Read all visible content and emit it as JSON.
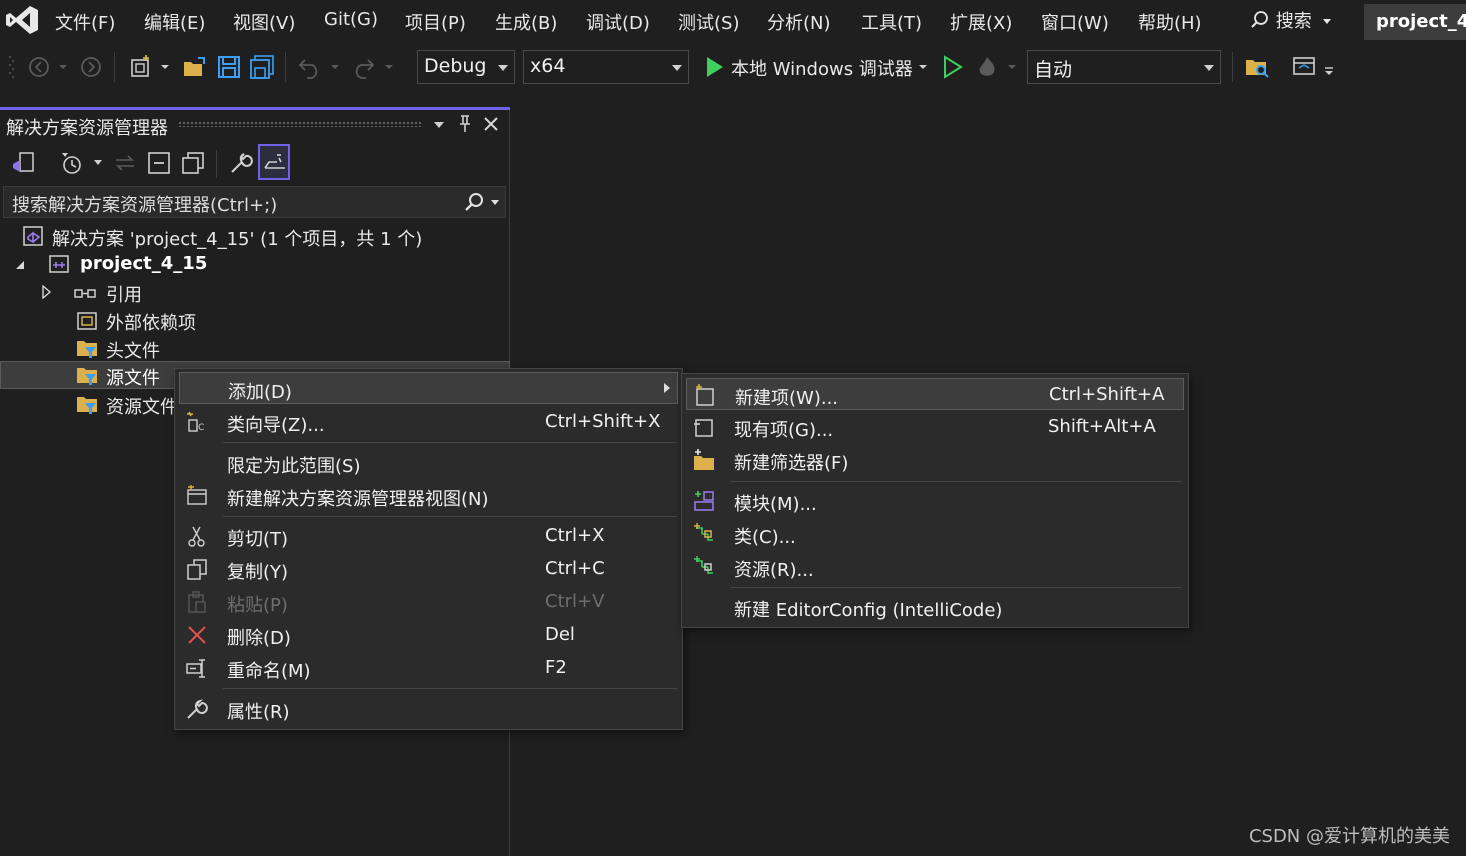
{
  "menubar": {
    "items": [
      "文件(F)",
      "编辑(E)",
      "视图(V)",
      "Git(G)",
      "项目(P)",
      "生成(B)",
      "调试(D)",
      "测试(S)",
      "分析(N)",
      "工具(T)",
      "扩展(X)",
      "窗口(W)",
      "帮助(H)"
    ],
    "search_label": "搜索",
    "project_badge": "project_4"
  },
  "toolbar": {
    "configuration": "Debug",
    "platform": "x64",
    "debugger_label": "本地 Windows 调试器",
    "auto_label": "自动"
  },
  "solution_explorer": {
    "title": "解决方案资源管理器",
    "search_placeholder": "搜索解决方案资源管理器(Ctrl+;)",
    "tree": {
      "solution": "解决方案 'project_4_15' (1 个项目，共 1 个)",
      "project": "project_4_15",
      "references": "引用",
      "external_deps": "外部依赖项",
      "header_files": "头文件",
      "source_files": "源文件",
      "resource_files": "资源文件"
    }
  },
  "context_menu": {
    "add": "添加(D)",
    "class_wizard": "类向导(Z)...",
    "class_wizard_shortcut": "Ctrl+Shift+X",
    "scope": "限定为此范围(S)",
    "new_view": "新建解决方案资源管理器视图(N)",
    "cut": "剪切(T)",
    "cut_shortcut": "Ctrl+X",
    "copy": "复制(Y)",
    "copy_shortcut": "Ctrl+C",
    "paste": "粘贴(P)",
    "paste_shortcut": "Ctrl+V",
    "delete": "删除(D)",
    "delete_shortcut": "Del",
    "rename": "重命名(M)",
    "rename_shortcut": "F2",
    "properties": "属性(R)"
  },
  "submenu": {
    "new_item": "新建项(W)...",
    "new_item_shortcut": "Ctrl+Shift+A",
    "existing_item": "现有项(G)...",
    "existing_item_shortcut": "Shift+Alt+A",
    "new_filter": "新建筛选器(F)",
    "module": "模块(M)...",
    "class": "类(C)...",
    "resource": "资源(R)...",
    "editorconfig": "新建 EditorConfig (IntelliCode)"
  },
  "watermark": "CSDN @爱计算机的美美",
  "colors": {
    "accent": "#7160e8",
    "play": "#3fcf5f",
    "save_blue": "#3a9ff5",
    "delete_red": "#e05252"
  }
}
